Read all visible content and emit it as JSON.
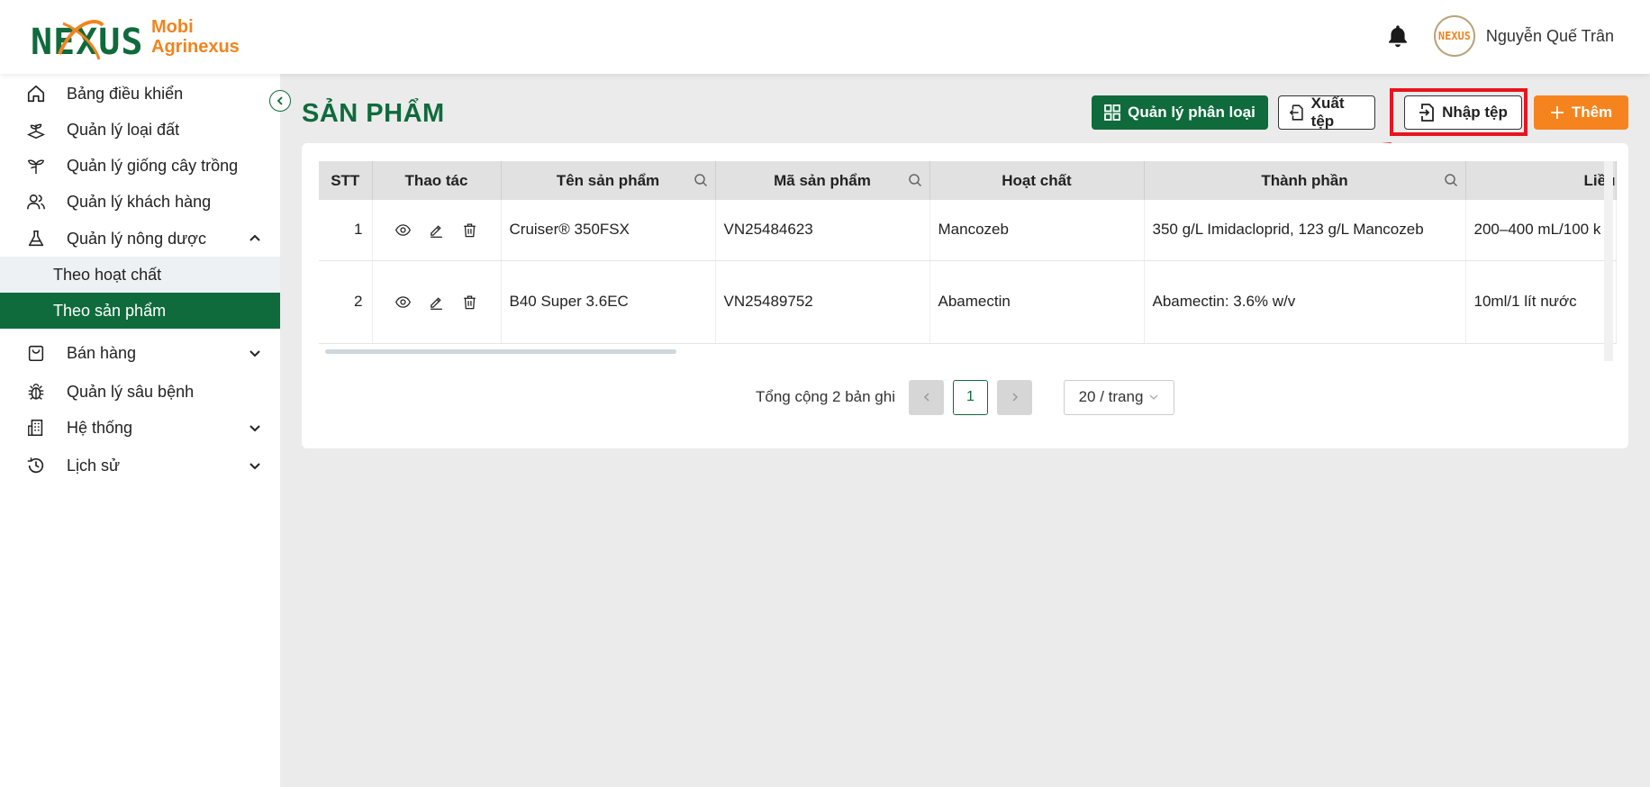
{
  "brand": {
    "logo_word": "NEXUS",
    "name_line1": "Mobi",
    "name_line2": "Agrinexus"
  },
  "header": {
    "user_name": "Nguyễn Quế Trân",
    "avatar_text": "NEXUS"
  },
  "sidebar": {
    "items": [
      {
        "label": "Bảng điều khiển",
        "icon": "home-icon"
      },
      {
        "label": "Quản lý loại đất",
        "icon": "soil-icon"
      },
      {
        "label": "Quản lý giống cây trồng",
        "icon": "plant-icon"
      },
      {
        "label": "Quản lý khách hàng",
        "icon": "users-icon"
      },
      {
        "label": "Quản lý nông dược",
        "icon": "flask-icon",
        "expanded": true
      },
      {
        "label": "Bán hàng",
        "icon": "shopping-bag-icon"
      },
      {
        "label": "Quản lý sâu bệnh",
        "icon": "bug-icon"
      },
      {
        "label": "Hệ thống",
        "icon": "building-icon"
      },
      {
        "label": "Lịch sử",
        "icon": "clock-icon"
      }
    ],
    "subitems": [
      {
        "label": "Theo hoạt chất"
      },
      {
        "label": "Theo sản phẩm",
        "active": true
      }
    ]
  },
  "page": {
    "title": "SẢN PHẨM"
  },
  "toolbar": {
    "manage_categories": "Quản lý phân loại",
    "export": "Xuất tệp",
    "import": "Nhập tệp",
    "add": "Thêm"
  },
  "table": {
    "columns": [
      "STT",
      "Thao tác",
      "Tên sản phẩm",
      "Mã sản phẩm",
      "Hoạt chất",
      "Thành phần",
      "Liều"
    ],
    "rows": [
      {
        "stt": "1",
        "name": "Cruiser® 350FSX",
        "code": "VN25484623",
        "active": "Mancozeb",
        "composition": "350 g/L Imidacloprid, 123 g/L Mancozeb",
        "dose": "200–400 mL/100 k"
      },
      {
        "stt": "2",
        "name": "B40 Super 3.6EC",
        "code": "VN25489752",
        "active": "Abamectin",
        "composition": "Abamectin: 3.6% w/v",
        "dose": "10ml/1 lít nước"
      }
    ]
  },
  "pagination": {
    "total": "Tổng cộng 2 bản ghi",
    "current_page": "1",
    "page_size": "20 / trang"
  },
  "colors": {
    "primary": "#0f6b3c",
    "accent": "#f5841f",
    "highlight": "#e8141e"
  }
}
